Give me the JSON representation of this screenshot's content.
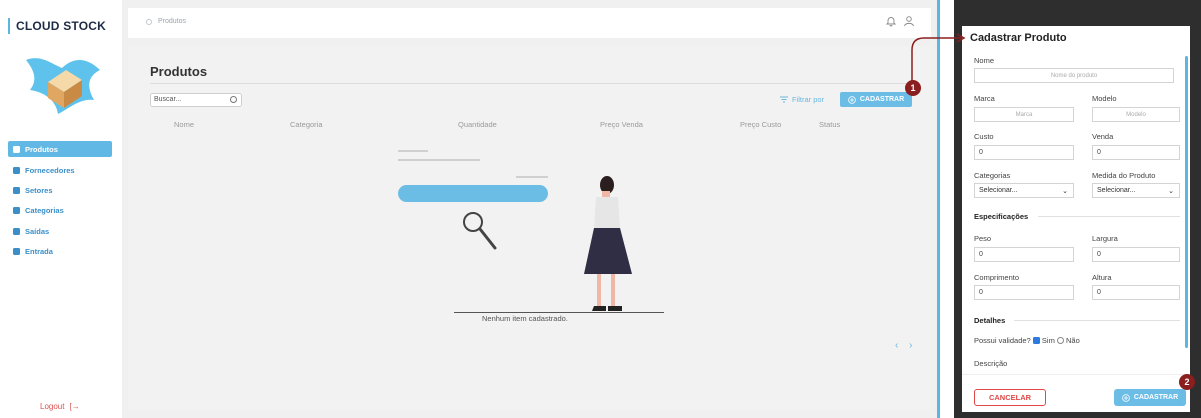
{
  "sidebar": {
    "brand": "CLOUD STOCK",
    "items": [
      {
        "label": "Produtos",
        "icon": "box-icon"
      },
      {
        "label": "Fornecedores",
        "icon": "users-icon"
      },
      {
        "label": "Setores",
        "icon": "grid-icon"
      },
      {
        "label": "Categorias",
        "icon": "tag-icon"
      },
      {
        "label": "Saídas",
        "icon": "exit-icon"
      },
      {
        "label": "Entrada",
        "icon": "entry-icon"
      }
    ],
    "logout": "Logout",
    "logout_icon": "[→"
  },
  "header": {
    "breadcrumb": "Produtos"
  },
  "main": {
    "title": "Produtos",
    "search_placeholder": "Buscar...",
    "filter_label": "Filtrar por",
    "register_label": "CADASTRAR",
    "columns": [
      "Nome",
      "Categoria",
      "Quantidade",
      "Preço Venda",
      "Preço Custo",
      "Status"
    ],
    "empty_text": "Nenhum item cadastrado.",
    "pager": "‹ ›"
  },
  "modal": {
    "title": "Cadastrar Produto",
    "fields": {
      "nome": {
        "label": "Nome",
        "placeholder": "Nome do produto"
      },
      "marca": {
        "label": "Marca",
        "placeholder": "Marca"
      },
      "modelo": {
        "label": "Modelo",
        "placeholder": "Modelo"
      },
      "custo": {
        "label": "Custo",
        "value": "0"
      },
      "venda": {
        "label": "Venda",
        "value": "0"
      },
      "categorias": {
        "label": "Categorias",
        "value": "Selecionar..."
      },
      "medida": {
        "label": "Medida do Produto",
        "value": "Selecionar..."
      },
      "peso": {
        "label": "Peso",
        "value": "0"
      },
      "largura": {
        "label": "Largura",
        "value": "0"
      },
      "comprimento": {
        "label": "Comprimento",
        "value": "0"
      },
      "altura": {
        "label": "Altura",
        "value": "0"
      },
      "descricao": {
        "label": "Descrição"
      }
    },
    "section_specs": "Especificações",
    "section_details": "Detalhes",
    "validade_label": "Possui validade?",
    "validade_yes": "Sim",
    "validade_no": "Não",
    "cancel_label": "CANCELAR",
    "save_label": "CADASTRAR"
  },
  "annotations": {
    "badge_1": "1",
    "badge_2": "2"
  },
  "colors": {
    "accent": "#62b8e4",
    "danger": "#e04848",
    "annotation": "#8b1e1e",
    "dark_overlay": "#2e2e2e"
  }
}
